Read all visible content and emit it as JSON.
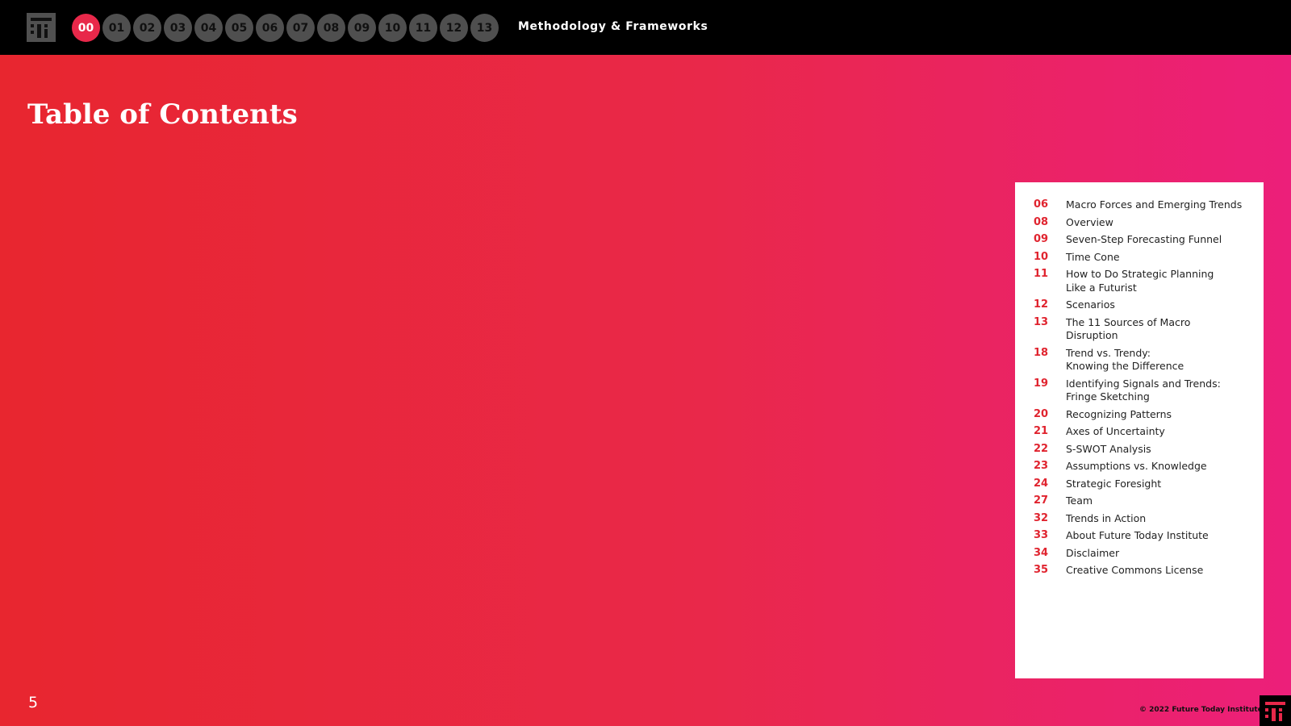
{
  "header": {
    "nav": [
      "00",
      "01",
      "02",
      "03",
      "04",
      "05",
      "06",
      "07",
      "08",
      "09",
      "10",
      "11",
      "12",
      "13"
    ],
    "active_index": 0,
    "section_title": "Methodology & Frameworks"
  },
  "main": {
    "title": "Table of Contents"
  },
  "toc": [
    {
      "page": "06",
      "lines": [
        "Macro Forces and Emerging Trends"
      ]
    },
    {
      "page": "08",
      "lines": [
        "Overview"
      ]
    },
    {
      "page": "09",
      "lines": [
        "Seven-Step Forecasting Funnel"
      ]
    },
    {
      "page": "10",
      "lines": [
        "Time Cone"
      ]
    },
    {
      "page": "11",
      "lines": [
        "How to Do Strategic Planning",
        "Like a Futurist"
      ]
    },
    {
      "page": "12",
      "lines": [
        "Scenarios"
      ]
    },
    {
      "page": "13",
      "lines": [
        "The 11 Sources of Macro",
        "Disruption"
      ]
    },
    {
      "page": "18",
      "lines": [
        "Trend vs. Trendy:",
        "Knowing the Difference"
      ]
    },
    {
      "page": "19",
      "lines": [
        "Identifying Signals and Trends:",
        "Fringe Sketching"
      ]
    },
    {
      "page": "20",
      "lines": [
        "Recognizing Patterns"
      ]
    },
    {
      "page": "21",
      "lines": [
        "Axes of Uncertainty"
      ]
    },
    {
      "page": "22",
      "lines": [
        "S-SWOT Analysis"
      ]
    },
    {
      "page": "23",
      "lines": [
        "Assumptions vs. Knowledge"
      ]
    },
    {
      "page": "24",
      "lines": [
        "Strategic Foresight"
      ]
    },
    {
      "page": "27",
      "lines": [
        "Team"
      ]
    },
    {
      "page": "32",
      "lines": [
        "Trends in Action"
      ]
    },
    {
      "page": "33",
      "lines": [
        "About Future Today Institute"
      ]
    },
    {
      "page": "34",
      "lines": [
        "Disclaimer"
      ]
    },
    {
      "page": "35",
      "lines": [
        "Creative Commons License"
      ]
    }
  ],
  "footer": {
    "page_number": "5",
    "copyright": "© 2022 Future Today Institute"
  },
  "colors": {
    "accent": "#e8284a",
    "toc_number": "#e0242f",
    "nav_inactive": "#4f4f4f",
    "topbar": "#000000"
  },
  "icons": {
    "top_logo": "fti-logo-icon",
    "corner_logo": "fti-logo-icon"
  }
}
